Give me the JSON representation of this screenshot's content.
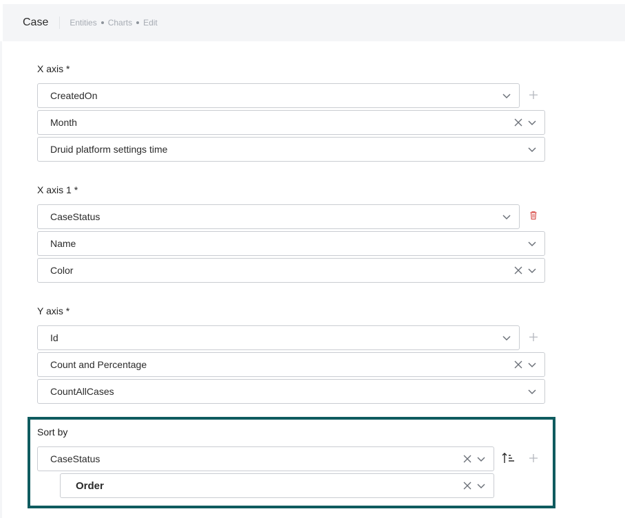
{
  "header": {
    "title": "Case",
    "breadcrumbs": [
      "Entities",
      "Charts",
      "Edit"
    ]
  },
  "x_axis": {
    "label": "X axis *",
    "field": "CreatedOn",
    "aggregation": "Month",
    "timezone": "Druid platform settings time"
  },
  "x_axis_1": {
    "label": "X axis 1 *",
    "field": "CaseStatus",
    "display": "Name",
    "color": "Color"
  },
  "y_axis": {
    "label": "Y axis *",
    "field": "Id",
    "aggregation": "Count and Percentage",
    "measure": "CountAllCases"
  },
  "sort_by": {
    "label": "Sort by",
    "field": "CaseStatus",
    "order": "Order"
  },
  "colors": {
    "accent_border": "#0f5b5f",
    "delete_icon": "#d9534f"
  }
}
